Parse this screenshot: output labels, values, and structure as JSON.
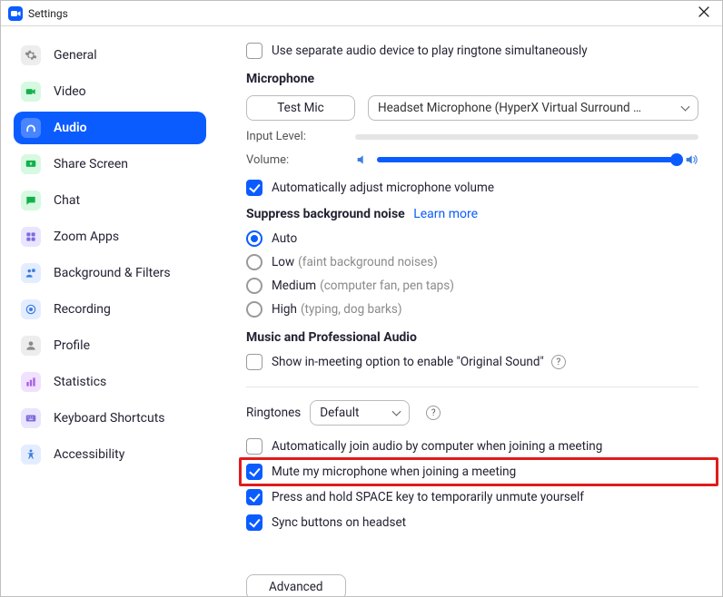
{
  "window": {
    "title": "Settings"
  },
  "sidebar": {
    "items": [
      {
        "label": "General"
      },
      {
        "label": "Video"
      },
      {
        "label": "Audio"
      },
      {
        "label": "Share Screen"
      },
      {
        "label": "Chat"
      },
      {
        "label": "Zoom Apps"
      },
      {
        "label": "Background & Filters"
      },
      {
        "label": "Recording"
      },
      {
        "label": "Profile"
      },
      {
        "label": "Statistics"
      },
      {
        "label": "Keyboard Shortcuts"
      },
      {
        "label": "Accessibility"
      }
    ],
    "selected_index": 2
  },
  "audio": {
    "separate_device_for_ringtone": {
      "checked": false,
      "label": "Use separate audio device to play ringtone simultaneously"
    },
    "microphone": {
      "section_title": "Microphone",
      "test_button": "Test Mic",
      "device_selected": "Headset Microphone (HyperX Virtual Surround …",
      "input_level_label": "Input Level:",
      "volume_label": "Volume:",
      "volume_percent": 100,
      "auto_adjust": {
        "checked": true,
        "label": "Automatically adjust microphone volume"
      }
    },
    "noise_suppression": {
      "section_title": "Suppress background noise",
      "learn_more": "Learn more",
      "selected": "auto",
      "options": {
        "auto": {
          "label": "Auto",
          "hint": ""
        },
        "low": {
          "label": "Low",
          "hint": "(faint background noises)"
        },
        "medium": {
          "label": "Medium",
          "hint": "(computer fan, pen taps)"
        },
        "high": {
          "label": "High",
          "hint": "(typing, dog barks)"
        }
      }
    },
    "music_pro": {
      "section_title": "Music and Professional Audio",
      "original_sound": {
        "checked": false,
        "label": "Show in-meeting option to enable \"Original Sound\""
      }
    },
    "ringtones": {
      "label": "Ringtones",
      "selected": "Default"
    },
    "joining": {
      "auto_join_audio": {
        "checked": false,
        "label": "Automatically join audio by computer when joining a meeting"
      },
      "mute_on_join": {
        "checked": true,
        "label": "Mute my microphone when joining a meeting"
      },
      "hold_space_unmute": {
        "checked": true,
        "label": "Press and hold SPACE key to temporarily unmute yourself"
      },
      "sync_headset": {
        "checked": true,
        "label": "Sync buttons on headset"
      }
    },
    "advanced_button": "Advanced"
  },
  "annotation": {
    "highlight_target": "mute_on_join"
  }
}
